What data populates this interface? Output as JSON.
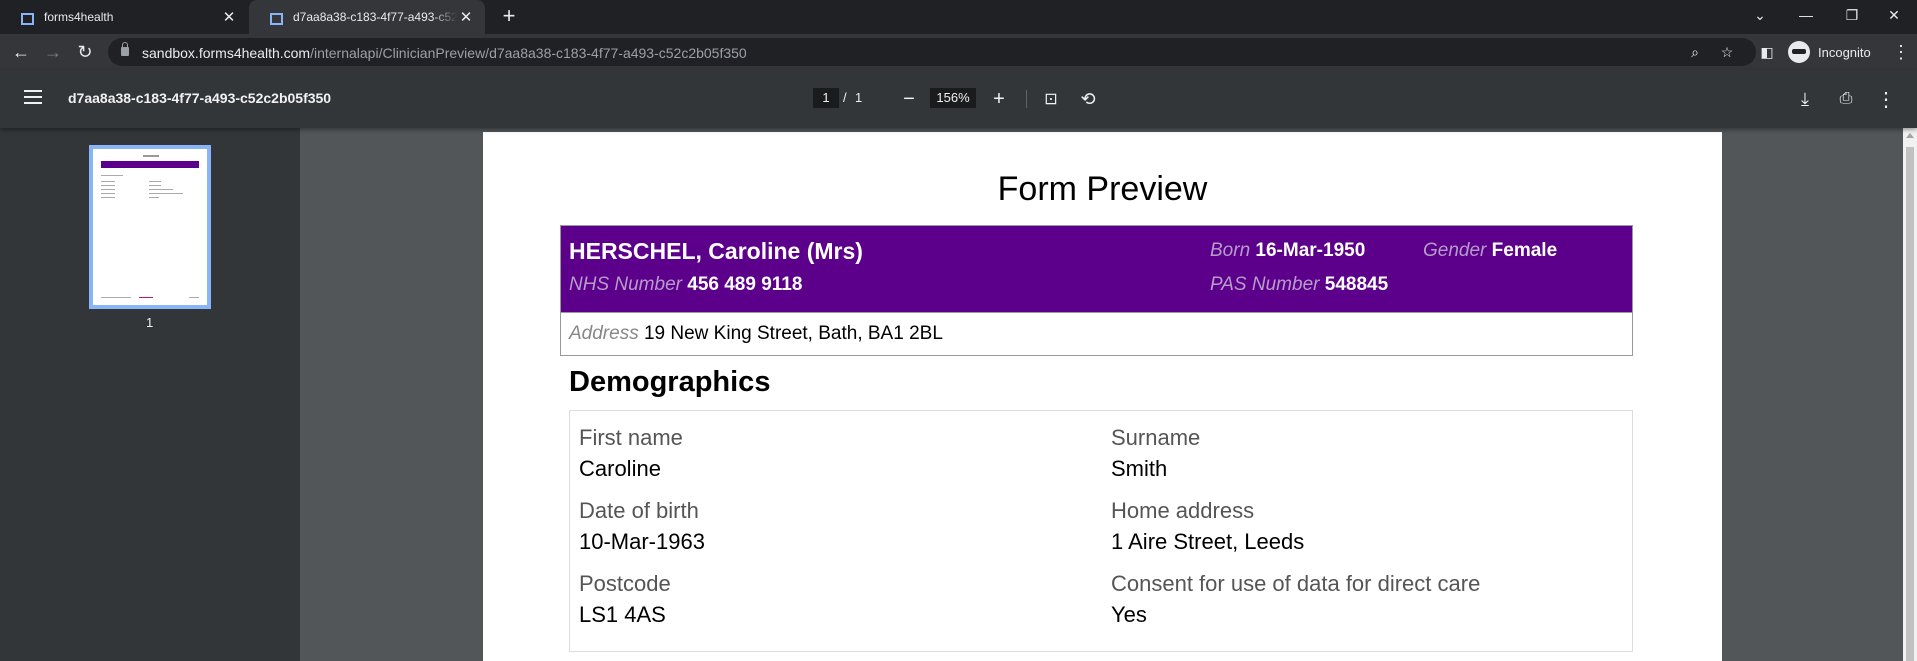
{
  "browser": {
    "tabs": [
      {
        "title": "forms4health"
      },
      {
        "title": "d7aa8a38-c183-4f77-a493-c52c2b05f350"
      }
    ],
    "url_host": "sandbox.forms4health.com",
    "url_path": "/internalapi/ClinicianPreview/d7aa8a38-c183-4f77-a493-c52c2b05f350",
    "profile_label": "Incognito"
  },
  "viewer": {
    "doc_title": "d7aa8a38-c183-4f77-a493-c52c2b05f350",
    "current_page": "1",
    "page_separator": "/",
    "total_pages": "1",
    "zoom": "156%",
    "thumbnail_label": "1"
  },
  "form": {
    "title": "Form Preview",
    "patient": {
      "name": "HERSCHEL, Caroline (Mrs)",
      "born_label": "Born",
      "born": "16-Mar-1950",
      "gender_label": "Gender",
      "gender": "Female",
      "nhs_label": "NHS Number",
      "nhs": "456 489 9118",
      "pas_label": "PAS Number",
      "pas": "548845",
      "address_label": "Address",
      "address": "19 New King Street, Bath, BA1 2BL"
    },
    "section_title": "Demographics",
    "fields": [
      {
        "label": "First name",
        "value": "Caroline"
      },
      {
        "label": "Surname",
        "value": "Smith"
      },
      {
        "label": "Date of birth",
        "value": "10-Mar-1963"
      },
      {
        "label": "Home address",
        "value": "1 Aire Street, Leeds"
      },
      {
        "label": "Postcode",
        "value": "LS1 4AS"
      },
      {
        "label": "Consent for use of data for direct care",
        "value": "Yes"
      }
    ]
  },
  "colors": {
    "banner": "#5c008c",
    "browser_frame": "#202124",
    "viewer_toolbar": "#323639",
    "doc_background": "#525659"
  }
}
